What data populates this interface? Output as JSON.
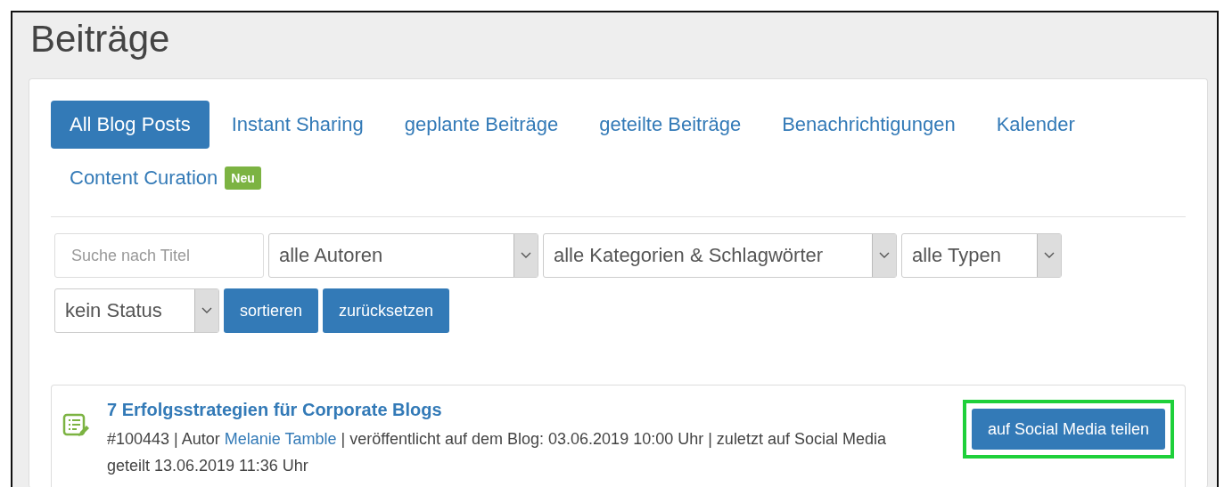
{
  "page_title": "Beiträge",
  "tabs": [
    {
      "label": "All Blog Posts",
      "selected": true
    },
    {
      "label": "Instant Sharing",
      "selected": false
    },
    {
      "label": "geplante Beiträge",
      "selected": false
    },
    {
      "label": "geteilte Beiträge",
      "selected": false
    },
    {
      "label": "Benachrichtigungen",
      "selected": false
    },
    {
      "label": "Kalender",
      "selected": false
    },
    {
      "label": "Content Curation",
      "selected": false,
      "badge": "Neu"
    }
  ],
  "filters": {
    "search": {
      "placeholder": "Suche nach Titel"
    },
    "selects": [
      {
        "value": "alle Autoren"
      },
      {
        "value": "alle Kategorien & Schlagwörter"
      },
      {
        "value": "alle Typen"
      },
      {
        "value": "kein Status"
      }
    ],
    "buttons": [
      "sortieren",
      "zurücksetzen"
    ]
  },
  "posts": [
    {
      "title": "7 Erfolgsstrategien für Corporate Blogs",
      "meta_before": "#100443 | Autor",
      "author": "Melanie Tamble",
      "meta_after": "| veröffentlicht auf dem Blog: 03.06.2019 10:00 Uhr | zuletzt auf Social Media geteilt 13.06.2019 11:36 Uhr",
      "action": "auf Social Media teilen",
      "highlighted": true
    }
  ]
}
